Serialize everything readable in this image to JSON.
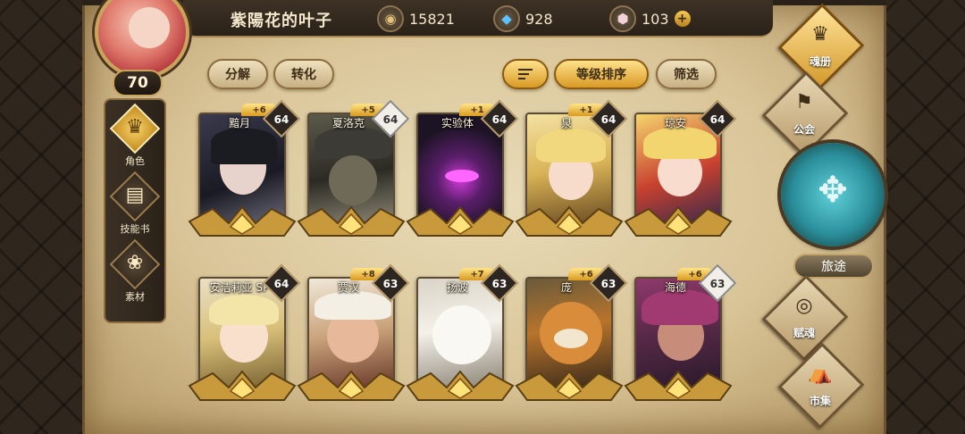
{
  "player": {
    "name": "紫陽花的叶子",
    "level": "70"
  },
  "currencies": [
    {
      "icon": "gold-coin-icon",
      "value": "15821"
    },
    {
      "icon": "blue-crystal-icon",
      "value": "928"
    },
    {
      "icon": "pink-gem-icon",
      "value": "103"
    }
  ],
  "left_nav": [
    {
      "label": "角色",
      "icon": "character-icon",
      "active": true
    },
    {
      "label": "技能书",
      "icon": "skill-book-icon",
      "active": false
    },
    {
      "label": "素材",
      "icon": "material-icon",
      "active": false
    }
  ],
  "toolbar": {
    "decompose": "分解",
    "convert": "转化",
    "sort_by_level": "等级排序",
    "filter": "筛选"
  },
  "heroes": [
    {
      "name": "黯月",
      "plus": "+6",
      "level": "64"
    },
    {
      "name": "夏洛克",
      "plus": "+5",
      "level": "64"
    },
    {
      "name": "实验体",
      "plus": "+1",
      "level": "64"
    },
    {
      "name": "泉",
      "plus": "+1",
      "level": "64"
    },
    {
      "name": "琼安",
      "plus": "",
      "level": "64"
    },
    {
      "name": "安洁莉亚 SP",
      "plus": "",
      "level": "64"
    },
    {
      "name": "贾汉",
      "plus": "+8",
      "level": "63"
    },
    {
      "name": "扬波",
      "plus": "+7",
      "level": "63"
    },
    {
      "name": "庞",
      "plus": "+6",
      "level": "63"
    },
    {
      "name": "海德",
      "plus": "+6",
      "level": "63"
    }
  ],
  "right_nav": {
    "soul_book": "魂册",
    "guild": "公会",
    "journey": "旅途",
    "endow_soul": "赋魂",
    "market": "市集"
  },
  "colors": {
    "accent_gold": "#d89a25",
    "parchment": "#e9dcb8",
    "journey_teal": "#2a8e9a"
  }
}
